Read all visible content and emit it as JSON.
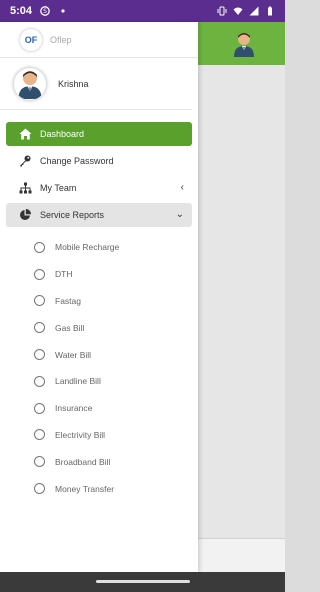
{
  "status_bar": {
    "time": "5:04",
    "icons": [
      "skype-icon",
      "dot-icon",
      "vibrate-icon",
      "wifi-icon",
      "signal-icon",
      "battery-icon"
    ]
  },
  "app": {
    "logo_text": "Oflep",
    "logo_badge": "OF"
  },
  "profile": {
    "name": "Krishna"
  },
  "menu": {
    "items": [
      {
        "label": "Dashboard",
        "icon": "home-icon",
        "state": "active"
      },
      {
        "label": "Change Password",
        "icon": "key-icon",
        "state": "normal"
      },
      {
        "label": "My Team",
        "icon": "hierarchy-icon",
        "state": "collapsed",
        "chevron": "‹"
      },
      {
        "label": "Service Reports",
        "icon": "pie-chart-icon",
        "state": "open",
        "chevron": "⌄"
      }
    ],
    "sub_items": [
      "Mobile Recharge",
      "DTH",
      "Fastag",
      "Gas Bill",
      "Water Bill",
      "Landline Bill",
      "Insurance",
      "Electrivity Bill",
      "Broadband Bill",
      "Money Transfer"
    ]
  },
  "colors": {
    "status_bar": "#5b2d8e",
    "accent_green": "#5aa02c",
    "header_green": "#6cb33f",
    "open_item_bg": "#e4e4e4"
  }
}
